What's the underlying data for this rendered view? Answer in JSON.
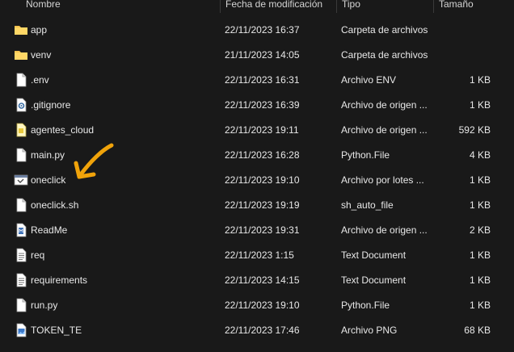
{
  "header": {
    "name": "Nombre",
    "date": "Fecha de modificación",
    "type": "Tipo",
    "size": "Tamaño"
  },
  "files": [
    {
      "name": "app",
      "date": "22/11/2023 16:37",
      "type": "Carpeta de archivos",
      "size": "",
      "icon": "folder-icon"
    },
    {
      "name": "venv",
      "date": "21/11/2023 14:05",
      "type": "Carpeta de archivos",
      "size": "",
      "icon": "folder-icon"
    },
    {
      "name": ".env",
      "date": "22/11/2023 16:31",
      "type": "Archivo ENV",
      "size": "1 KB",
      "icon": "file-icon"
    },
    {
      "name": ".gitignore",
      "date": "22/11/2023 16:39",
      "type": "Archivo de origen ...",
      "size": "1 KB",
      "icon": "gear-file-icon"
    },
    {
      "name": "agentes_cloud",
      "date": "22/11/2023 19:11",
      "type": "Archivo de origen ...",
      "size": "592 KB",
      "icon": "source-file-icon"
    },
    {
      "name": "main.py",
      "date": "22/11/2023 16:28",
      "type": "Python.File",
      "size": "4 KB",
      "icon": "file-icon"
    },
    {
      "name": "oneclick",
      "date": "22/11/2023 19:10",
      "type": "Archivo por lotes ...",
      "size": "1 KB",
      "icon": "batch-file-icon"
    },
    {
      "name": "oneclick.sh",
      "date": "22/11/2023 19:19",
      "type": "sh_auto_file",
      "size": "1 KB",
      "icon": "file-icon"
    },
    {
      "name": "ReadMe",
      "date": "22/11/2023 19:31",
      "type": "Archivo de origen ...",
      "size": "2 KB",
      "icon": "markdown-file-icon"
    },
    {
      "name": "req",
      "date": "22/11/2023 1:15",
      "type": "Text Document",
      "size": "1 KB",
      "icon": "text-file-icon"
    },
    {
      "name": "requirements",
      "date": "22/11/2023 14:15",
      "type": "Text Document",
      "size": "1 KB",
      "icon": "text-file-icon"
    },
    {
      "name": "run.py",
      "date": "22/11/2023 19:10",
      "type": "Python.File",
      "size": "1 KB",
      "icon": "file-icon"
    },
    {
      "name": "TOKEN_TE",
      "date": "22/11/2023 17:46",
      "type": "Archivo PNG",
      "size": "68 KB",
      "icon": "image-file-icon"
    }
  ],
  "colors": {
    "background": "#191919",
    "text": "#e8e8e8",
    "folder": "#f2c14e",
    "annotation_arrow": "#f0a30a"
  }
}
